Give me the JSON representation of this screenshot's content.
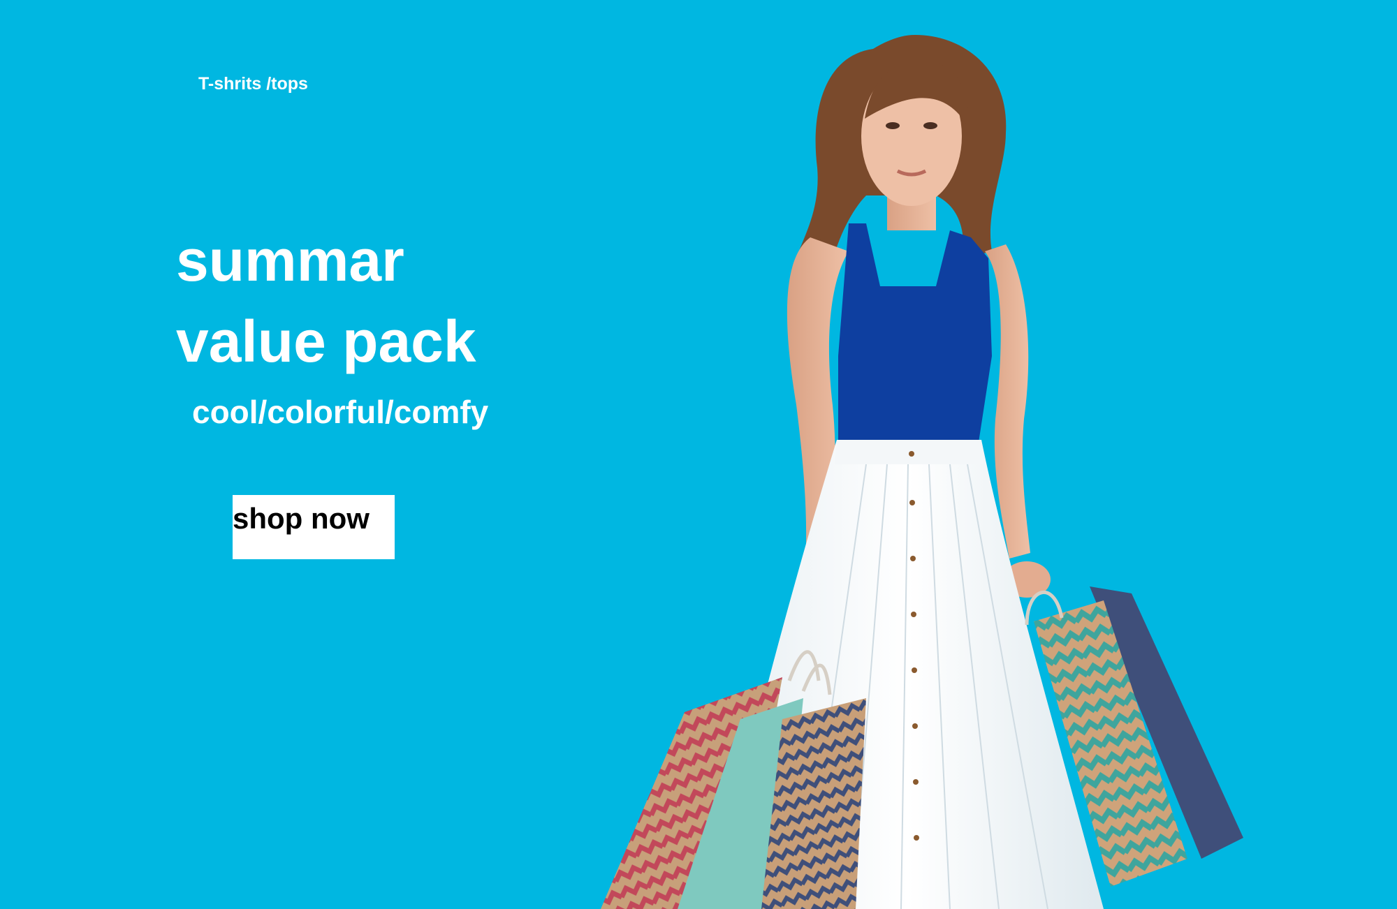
{
  "hero": {
    "category_label": "T-shrits /tops",
    "headline_line1": "summar",
    "headline_line2": "value pack",
    "tagline": "cool/colorful/comfy",
    "cta_label": "shop now"
  },
  "colors": {
    "background": "#00b7e1",
    "text": "#ffffff",
    "button_bg": "#ffffff",
    "button_text": "#000000"
  },
  "photo": {
    "subject": "woman-with-shopping-bags"
  }
}
